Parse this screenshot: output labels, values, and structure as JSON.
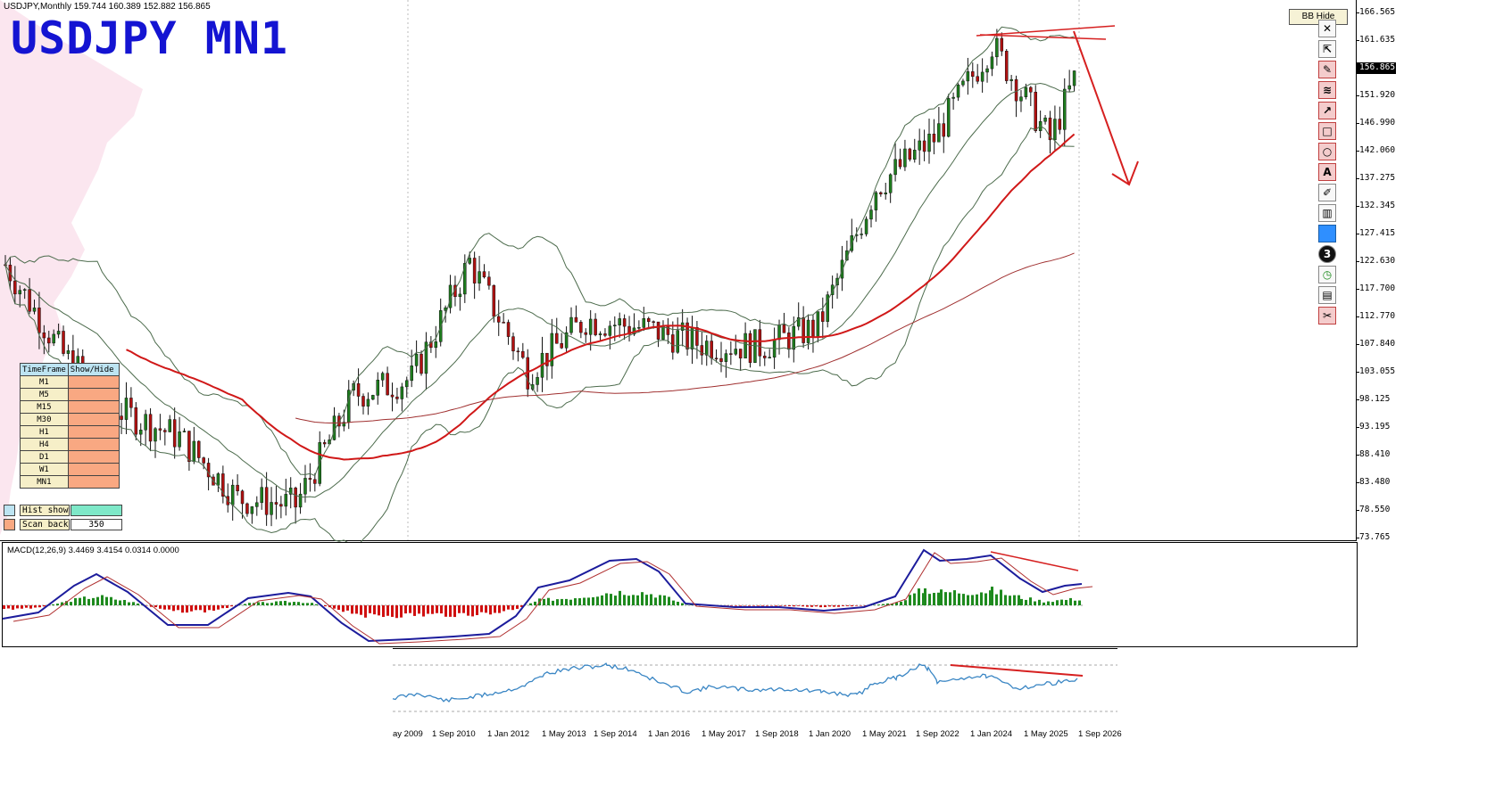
{
  "header": {
    "symbol_line": "USDJPY,Monthly  159.744 160.389 152.882 156.865",
    "title": "USDJPY MN1",
    "bb_button": "BB Hide"
  },
  "price_axis": {
    "ticks": [
      "166.565",
      "161.635",
      "156.865",
      "151.920",
      "146.990",
      "142.060",
      "137.275",
      "132.345",
      "127.415",
      "122.630",
      "117.700",
      "112.770",
      "107.840",
      "103.055",
      "98.125",
      "93.195",
      "88.410",
      "83.480",
      "78.550",
      "73.765"
    ],
    "current": "156.865"
  },
  "tf_panel": {
    "headers": [
      "TimeFrame",
      "Show/Hide"
    ],
    "rows": [
      "M1",
      "M5",
      "M15",
      "M30",
      "H1",
      "H4",
      "D1",
      "W1",
      "MN1"
    ],
    "cell_color": "#f9a882",
    "hist_label": "Hist show",
    "hist_color": "#7ee8c8",
    "scan_label": "Scan back",
    "scan_value": "350"
  },
  "toolbar": {
    "icons": [
      "close-icon",
      "cursor-icon",
      "pencil-icon",
      "fibonacci-icon",
      "arrow-line-icon",
      "rectangle-icon",
      "ellipse-icon",
      "text-icon",
      "paint-icon",
      "trash-icon",
      "color-swatch-icon",
      "count-icon",
      "clock-icon",
      "screenshot-icon",
      "scissors-icon"
    ],
    "count_label": "3",
    "text_label": "A",
    "close_label": "✕"
  },
  "macd": {
    "label": "MACD(12,26,9) 3.4469 3.4154 0.0314 0.0000"
  },
  "date_axis": {
    "labels": [
      "ay 2009",
      "1 Sep 2010",
      "1 Jan 2012",
      "1 May 2013",
      "1 Sep 2014",
      "1 Jan 2016",
      "1 May 2017",
      "1 Sep 2018",
      "1 Jan 2020",
      "1 May 2021",
      "1 Sep 2022",
      "1 Jan 2024",
      "1 May 2025",
      "1 Sep 2026"
    ]
  },
  "chart_data": {
    "type": "line",
    "title": "USDJPY MN1",
    "xlabel": "",
    "ylabel": "",
    "ylim": [
      73.765,
      166.565
    ],
    "colors": {
      "bull": "#1e7d1e",
      "bear": "#b01010",
      "ma": "#d01818",
      "macd": "#1c1c9c",
      "signal": "#b03030",
      "rsi": "#3a86c4"
    },
    "series": [
      {
        "x": [
          "2007-06",
          "2008-06",
          "2009-06",
          "2010-06",
          "2011-06",
          "2012-06",
          "2013-06",
          "2014-06",
          "2015-06",
          "2016-06",
          "2017-06",
          "2018-06",
          "2019-06",
          "2020-06",
          "2021-06",
          "2022-06",
          "2023-06",
          "2024-06",
          "2025-06",
          "2025-12"
        ],
        "y": [
          122.0,
          106.0,
          96.0,
          91.5,
          80.7,
          79.5,
          99.0,
          101.8,
          122.5,
          103.0,
          112.3,
          110.8,
          108.0,
          107.5,
          111.0,
          135.7,
          144.3,
          161.0,
          144.0,
          156.865
        ]
      }
    ]
  }
}
